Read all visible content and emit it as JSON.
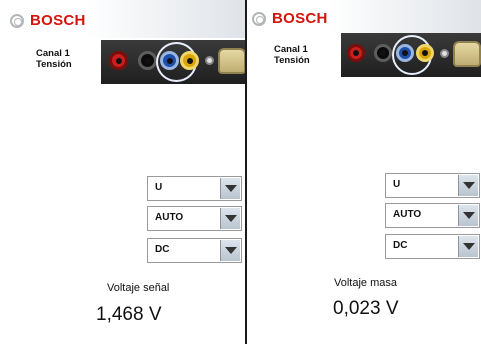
{
  "brand": {
    "name": "BOSCH",
    "color": "#d3150c"
  },
  "panels": [
    {
      "channel_line1": "Canal 1",
      "channel_line2": "Tensión",
      "dropdowns": [
        "U",
        "AUTO",
        "DC"
      ],
      "measure_label": "Voltaje señal",
      "measure_value": "1,468 V"
    },
    {
      "channel_line1": "Canal 1",
      "channel_line2": "Tensión",
      "dropdowns": [
        "U",
        "AUTO",
        "DC"
      ],
      "measure_label": "Voltaje masa",
      "measure_value": "0,023 V"
    }
  ],
  "icons": [
    "bosch-logo-icon",
    "dropdown-arrow-icon",
    "input-jack-icon"
  ],
  "jack_colors": {
    "red": "#c8201e",
    "black": "#0b0b0b",
    "blue": "#1e4fa9",
    "yellow": "#d9a509"
  }
}
